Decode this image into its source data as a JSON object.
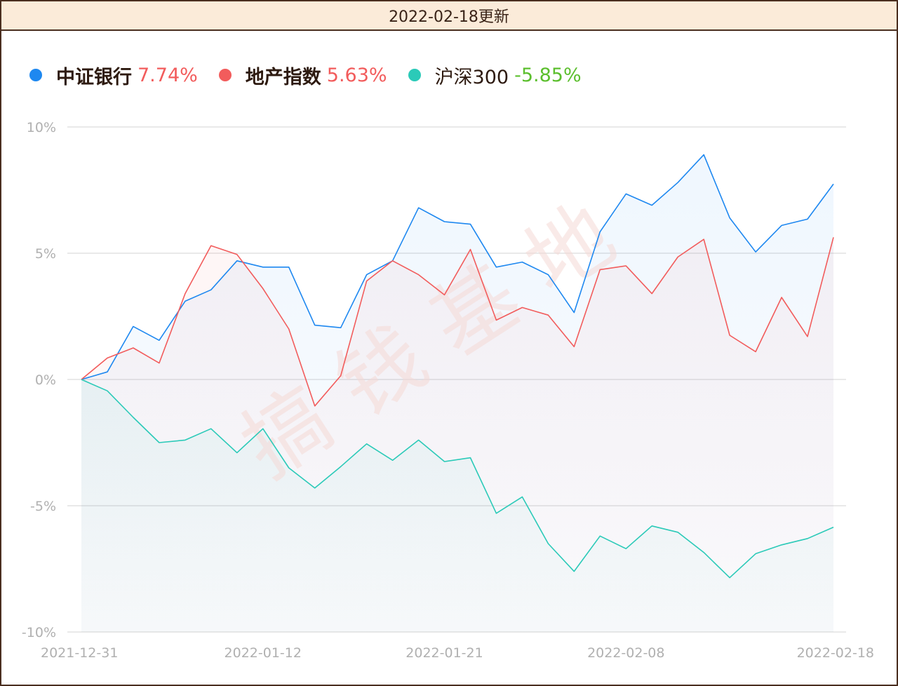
{
  "header": {
    "title": "2022-02-18更新"
  },
  "watermark": "搞钱基地",
  "chart_data": {
    "type": "line",
    "yticks": [
      "10%",
      "5%",
      "0%",
      "-5%",
      "-10%"
    ],
    "ytick_values": [
      10,
      5,
      0,
      -5,
      -10
    ],
    "ylim": [
      -10,
      10
    ],
    "xtick_labels": [
      "2021-12-31",
      "2022-01-12",
      "2022-01-21",
      "2022-02-08",
      "2022-02-18"
    ],
    "xtick_index": [
      0,
      7,
      14,
      21,
      29
    ],
    "grid": true,
    "legend_position": "top-left",
    "series": [
      {
        "name": "中证银行",
        "final_label": "7.74%",
        "color": "#1e88f0",
        "value_color": "#f25c5c",
        "bold": true,
        "values": [
          0,
          0.3,
          2.1,
          1.55,
          3.1,
          3.55,
          4.7,
          4.45,
          4.45,
          2.15,
          2.05,
          4.15,
          4.7,
          6.8,
          6.25,
          6.15,
          4.45,
          4.65,
          4.15,
          2.65,
          5.85,
          7.35,
          6.9,
          7.8,
          8.9,
          6.4,
          5.05,
          6.1,
          6.35,
          7.74
        ]
      },
      {
        "name": "地产指数",
        "final_label": "5.63%",
        "color": "#f25c5c",
        "value_color": "#f25c5c",
        "bold": true,
        "values": [
          0,
          0.85,
          1.25,
          0.65,
          3.4,
          5.3,
          4.95,
          3.6,
          2.0,
          -1.05,
          0.15,
          3.9,
          4.7,
          4.15,
          3.35,
          5.15,
          2.35,
          2.85,
          2.55,
          1.3,
          4.35,
          4.5,
          3.4,
          4.85,
          5.55,
          1.75,
          1.1,
          3.25,
          1.7,
          5.63
        ]
      },
      {
        "name": "沪深300",
        "final_label": "-5.85%",
        "color": "#2bcab8",
        "value_color": "#5cbf2e",
        "bold": false,
        "values": [
          0,
          -0.45,
          -1.5,
          -2.5,
          -2.4,
          -1.95,
          -2.9,
          -1.95,
          -3.5,
          -4.3,
          -3.45,
          -2.55,
          -3.2,
          -2.4,
          -3.25,
          -3.1,
          -5.3,
          -4.65,
          -6.5,
          -7.6,
          -6.2,
          -6.7,
          -5.8,
          -6.05,
          -6.85,
          -7.85,
          -6.9,
          -6.55,
          -6.3,
          -5.85
        ]
      }
    ]
  }
}
